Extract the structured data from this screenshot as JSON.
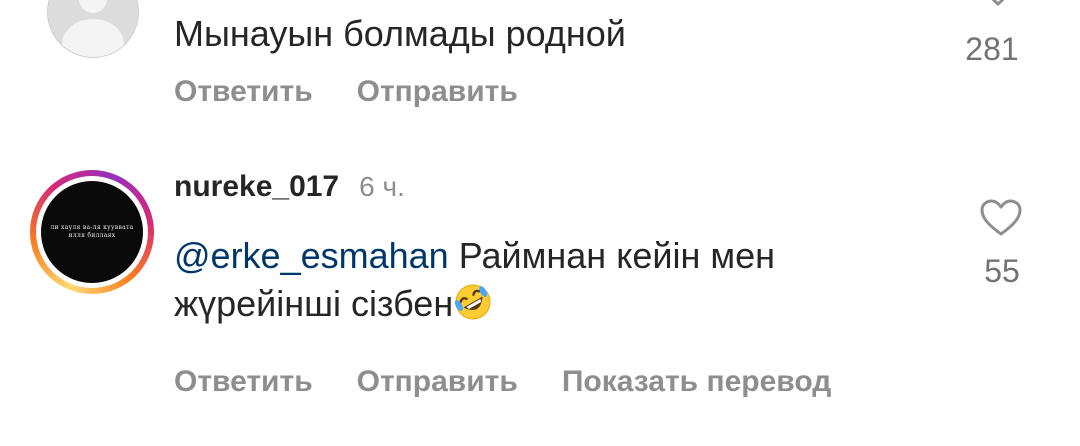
{
  "comment_previous": {
    "text": "Мынауын болмады родной",
    "like_count": "281",
    "reply_label": "Ответить",
    "send_label": "Отправить"
  },
  "comment_current": {
    "username": "nureke_017",
    "time_ago": "6 ч.",
    "avatar_text_line1": "ли хауля ва-ля кууввата",
    "avatar_text_line2": "илля биллаях",
    "mention": "@erke_esmahan",
    "text_part1": " Раймнан кейін мен",
    "text_part2": "жүрейінші сізбен",
    "emoji": "rolling-on-floor-laughing-emoji",
    "like_count": "55",
    "reply_label": "Ответить",
    "send_label": "Отправить",
    "translate_label": "Показать перевод"
  },
  "colors": {
    "text_primary": "#262626",
    "text_secondary": "#8e8e8e",
    "mention": "#00376b",
    "icon": "#8e8e8e"
  }
}
